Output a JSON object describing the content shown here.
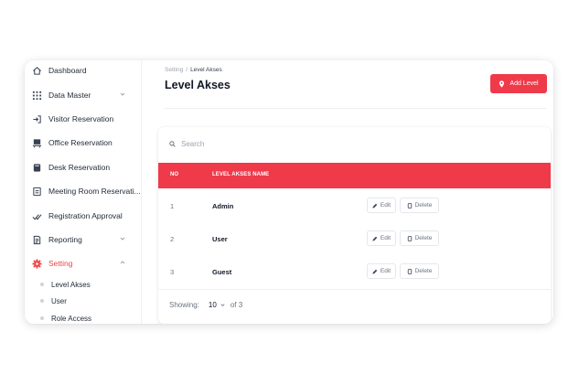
{
  "sidebar": {
    "items": [
      {
        "label": "Dashboard",
        "icon": "home-icon"
      },
      {
        "label": "Data Master",
        "icon": "grid-icon",
        "has_chevron": true
      },
      {
        "label": "Visitor Reservation",
        "icon": "login-icon"
      },
      {
        "label": "Office Reservation",
        "icon": "office-icon"
      },
      {
        "label": "Desk Reservation",
        "icon": "desk-icon"
      },
      {
        "label": "Meeting Room Reservati...",
        "icon": "room-icon"
      },
      {
        "label": "Registration Approval",
        "icon": "approval-icon"
      },
      {
        "label": "Reporting",
        "icon": "report-icon",
        "has_chevron": true
      },
      {
        "label": "Setting",
        "icon": "gear-icon",
        "has_chevron": true,
        "active": true
      }
    ],
    "sub_items": [
      {
        "label": "Level Akses"
      },
      {
        "label": "User"
      },
      {
        "label": "Role Access"
      }
    ]
  },
  "breadcrumb": {
    "parent": "Setting",
    "separator": "/",
    "current": "Level Akses"
  },
  "page": {
    "title": "Level Akses"
  },
  "toolbar": {
    "add_label": "Add Level"
  },
  "search": {
    "placeholder": "Search"
  },
  "table": {
    "columns": [
      "NO",
      "LEVEL AKSES NAME"
    ],
    "rows": [
      {
        "no": "1",
        "name": "Admin"
      },
      {
        "no": "2",
        "name": "User"
      },
      {
        "no": "3",
        "name": "Guest"
      }
    ],
    "edit_label": "Edit",
    "delete_label": "Delete"
  },
  "pagination": {
    "showing_label": "Showing:",
    "per_page": "10",
    "total_label": "of 3"
  },
  "colors": {
    "accent": "#ef3a4a",
    "text": "#1f2937",
    "muted": "#9ca3af"
  }
}
